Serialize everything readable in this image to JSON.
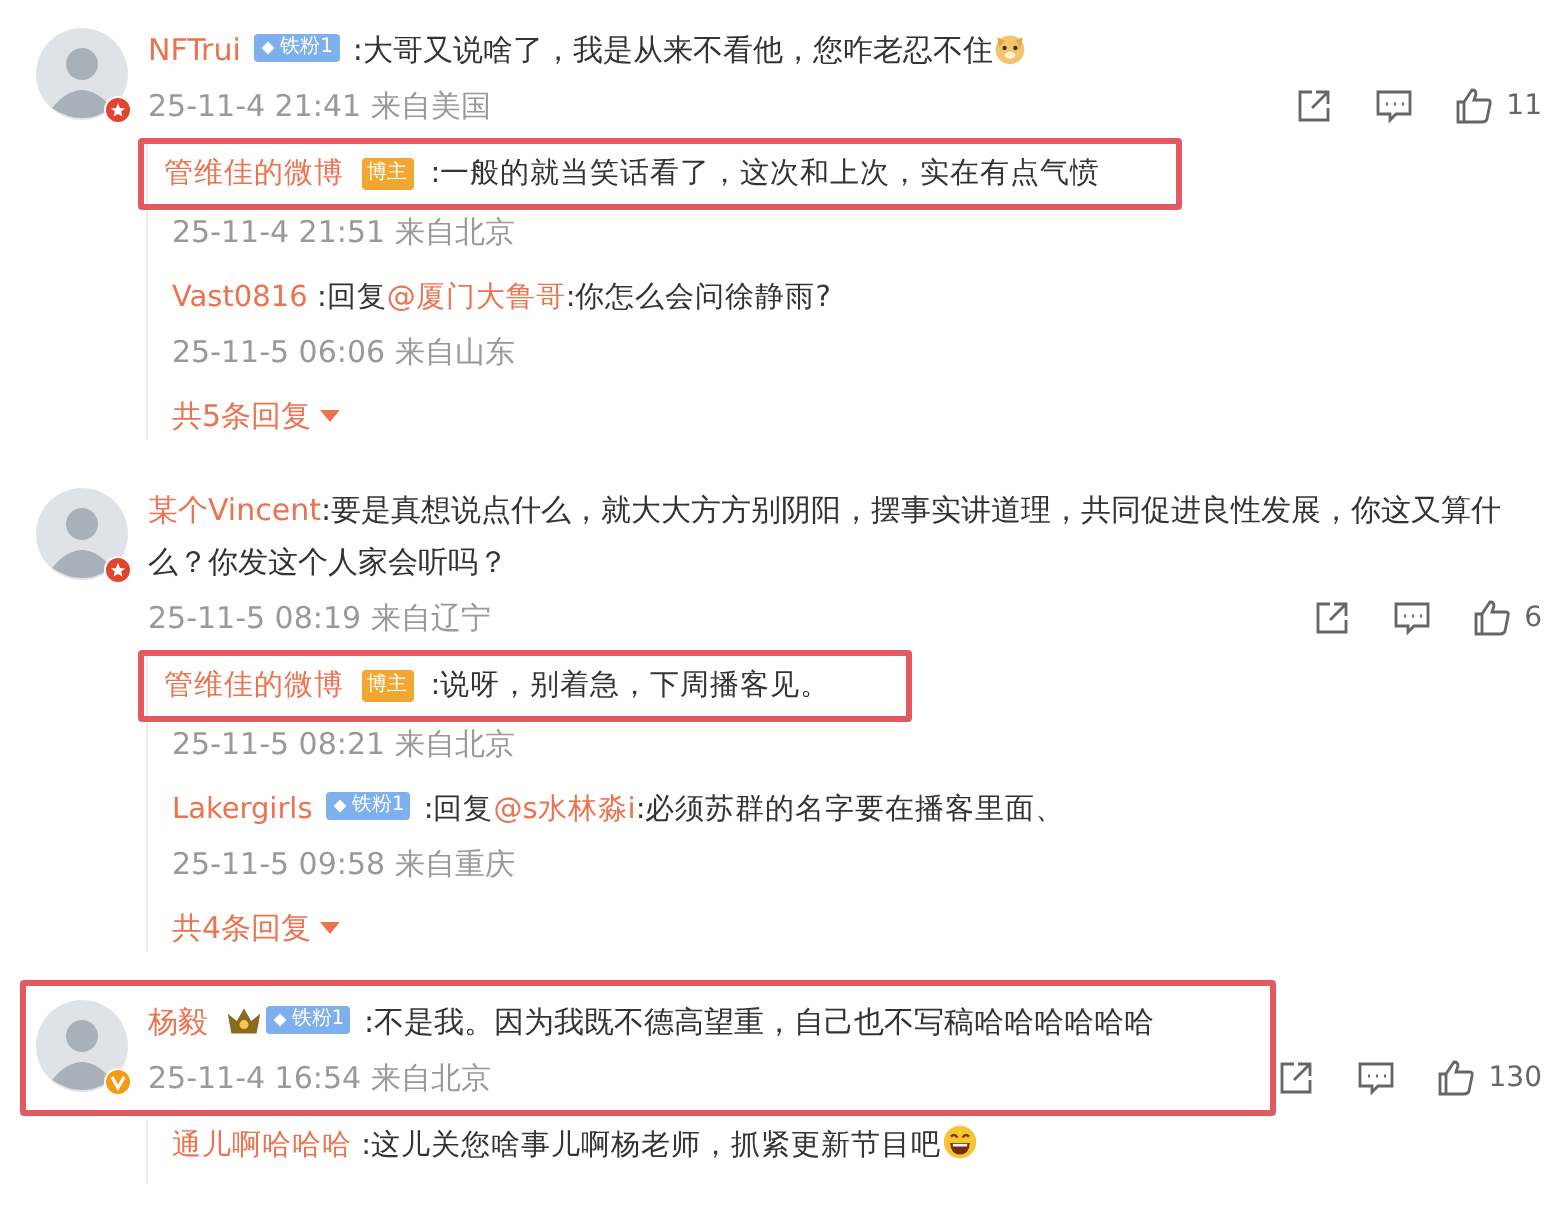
{
  "comments": [
    {
      "name": "NFTrui",
      "verified": false,
      "badges": [
        {
          "kind": "fan",
          "label": "铁粉1"
        }
      ],
      "text": ":大哥又说啥了，我是从来不看他，您咋老忍不住",
      "emoji": {
        "kind": "dog"
      },
      "time": "25-11-4 21:41",
      "location": "来自美国",
      "likes": "11",
      "highlighted": false,
      "replies": [
        {
          "name": "管维佳的微博",
          "badges": [
            {
              "kind": "owner",
              "label": "博主"
            }
          ],
          "text": ":一般的就当笑话看了，这次和上次，实在有点气愤",
          "time": "25-11-4 21:51",
          "location": "来自北京",
          "highlighted": true
        },
        {
          "name": "Vast0816",
          "prefix": ":回复",
          "mention": "@厦门大鲁哥",
          "text": ":你怎么会问徐静雨?",
          "time": "25-11-5 06:06",
          "location": "来自山东",
          "highlighted": false
        }
      ],
      "more": "共5条回复"
    },
    {
      "name": "某个Vincent",
      "verified": false,
      "text": ":要是真想说点什么，就大大方方别阴阳，摆事实讲道理，共同促进良性发展，你这又算什么？你发这个人家会听吗？",
      "time": "25-11-5 08:19",
      "location": "来自辽宁",
      "likes": "6",
      "highlighted": false,
      "replies": [
        {
          "name": "管维佳的微博",
          "badges": [
            {
              "kind": "owner",
              "label": "博主"
            }
          ],
          "text": ":说呀，别着急，下周播客见。",
          "time": "25-11-5 08:21",
          "location": "来自北京",
          "highlighted": true
        },
        {
          "name": "Lakergirls",
          "badges": [
            {
              "kind": "fan",
              "label": "铁粉1"
            }
          ],
          "prefix": ":回复",
          "mention": "@s水林淼i",
          "text": ":必须苏群的名字要在播客里面、",
          "time": "25-11-5 09:58",
          "location": "来自重庆",
          "highlighted": false
        }
      ],
      "more": "共4条回复"
    },
    {
      "name": "杨毅",
      "verified": true,
      "badges": [
        {
          "kind": "crown"
        },
        {
          "kind": "fan",
          "label": "铁粉1"
        }
      ],
      "text": ":不是我。因为我既不德高望重，自己也不写稿哈哈哈哈哈哈",
      "time": "25-11-4 16:54",
      "location": "来自北京",
      "likes": "130",
      "highlighted": true,
      "replies": [
        {
          "name": "通儿啊哈哈哈",
          "text": ":这儿关您啥事儿啊杨老师，抓紧更新节目吧",
          "emoji": {
            "kind": "laugh"
          },
          "highlighted": false
        }
      ]
    }
  ]
}
